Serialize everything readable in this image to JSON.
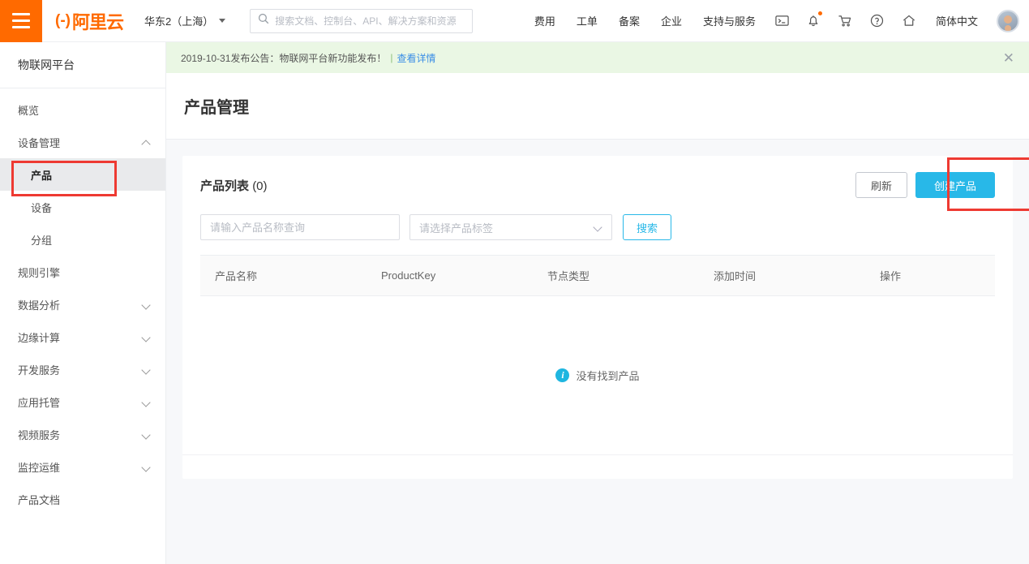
{
  "header": {
    "menu_icon": "hamburger-icon",
    "brand": "阿里云",
    "brand_mark": "(-)",
    "region": "华东2（上海）",
    "search_placeholder": "搜索文档、控制台、API、解决方案和资源",
    "search_value": "",
    "nav_links": [
      {
        "label": "费用"
      },
      {
        "label": "工单"
      },
      {
        "label": "备案"
      },
      {
        "label": "企业"
      },
      {
        "label": "支持与服务"
      }
    ],
    "nav_icons": [
      {
        "name": "terminal-icon"
      },
      {
        "name": "bell-icon",
        "badge": true
      },
      {
        "name": "cart-icon"
      },
      {
        "name": "help-icon"
      },
      {
        "name": "home-icon"
      }
    ],
    "language": "简体中文",
    "avatar": "user-avatar"
  },
  "banner": {
    "text": "2019-10-31发布公告：物联网平台新功能发布！",
    "link": "查看详情",
    "close_icon": "close-icon",
    "bg_color": "#eaf7e4"
  },
  "sidebar": {
    "title": "物联网平台",
    "items": [
      {
        "label": "概览",
        "level": 0,
        "expandable": false,
        "selected": false
      },
      {
        "label": "设备管理",
        "level": 0,
        "expandable": true,
        "expanded": true,
        "selected": false
      },
      {
        "label": "产品",
        "level": 1,
        "expandable": false,
        "selected": true
      },
      {
        "label": "设备",
        "level": 1,
        "expandable": false,
        "selected": false
      },
      {
        "label": "分组",
        "level": 1,
        "expandable": false,
        "selected": false
      },
      {
        "label": "规则引擎",
        "level": 0,
        "expandable": false,
        "selected": false
      },
      {
        "label": "数据分析",
        "level": 0,
        "expandable": true,
        "expanded": false,
        "selected": false
      },
      {
        "label": "边缘计算",
        "level": 0,
        "expandable": true,
        "expanded": false,
        "selected": false
      },
      {
        "label": "开发服务",
        "level": 0,
        "expandable": true,
        "expanded": false,
        "selected": false
      },
      {
        "label": "应用托管",
        "level": 0,
        "expandable": true,
        "expanded": false,
        "selected": false
      },
      {
        "label": "视频服务",
        "level": 0,
        "expandable": true,
        "expanded": false,
        "selected": false
      },
      {
        "label": "监控运维",
        "level": 0,
        "expandable": true,
        "expanded": false,
        "selected": false
      },
      {
        "label": "产品文档",
        "level": 0,
        "expandable": false,
        "selected": false
      }
    ]
  },
  "page": {
    "title": "产品管理"
  },
  "product_list": {
    "title": "产品列表",
    "count_label": "(0)",
    "refresh_label": "刷新",
    "create_label": "创建产品",
    "name_filter_placeholder": "请输入产品名称查询",
    "name_filter_value": "",
    "tag_filter_value": "请选择产品标签",
    "search_label": "搜索",
    "columns": [
      "产品名称",
      "ProductKey",
      "节点类型",
      "添加时间",
      "操作"
    ],
    "rows": [],
    "empty_text": "没有找到产品",
    "empty_icon": "info-icon"
  },
  "annotations": {
    "sidebar_highlight_color": "#ee3a32",
    "create_button_highlight_color": "#ee3a32"
  },
  "colors": {
    "brand_orange": "#ff6a00",
    "primary_blue": "#28b8e8",
    "banner_green": "#eaf7e4",
    "page_bg": "#f7f8fa"
  }
}
